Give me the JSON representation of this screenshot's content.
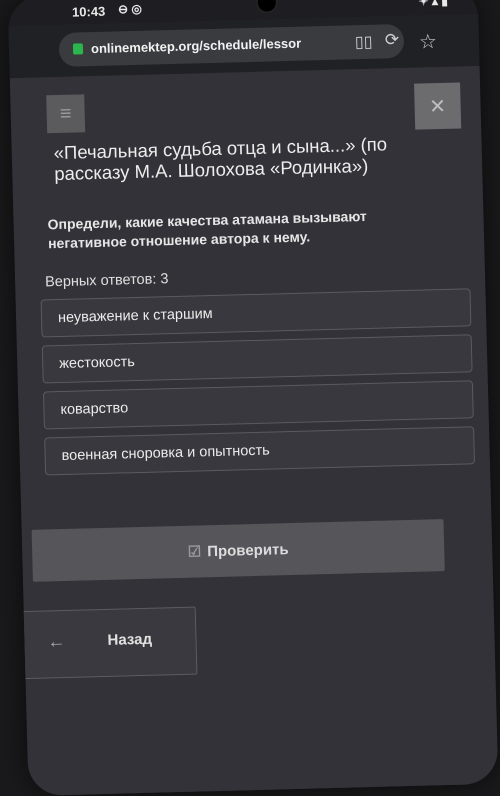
{
  "status_bar": {
    "time": "10:43",
    "icons": "⊖ ◎",
    "right_icons": "✦ ▴ ▮"
  },
  "browser": {
    "url": "onlinemektep.org/schedule/lessor"
  },
  "lesson": {
    "title": "«Печальная судьба отца и сына...» (по рассказу М.А. Шолохова «Родинка»)",
    "question": "Определи, какие качества атамана вызывают негативное отношение автора к нему.",
    "correct_answers_label": "Верных ответов: 3"
  },
  "answers": [
    "неуважение к старшим",
    "жестокость",
    "коварство",
    "военная сноровка и опытность"
  ],
  "buttons": {
    "check": "Проверить",
    "back": "Назад"
  },
  "icons": {
    "menu": "≡",
    "close": "✕",
    "check": "☑",
    "back_arrow": "←",
    "reader": "▯▯",
    "reload": "⟳",
    "star": "☆"
  }
}
